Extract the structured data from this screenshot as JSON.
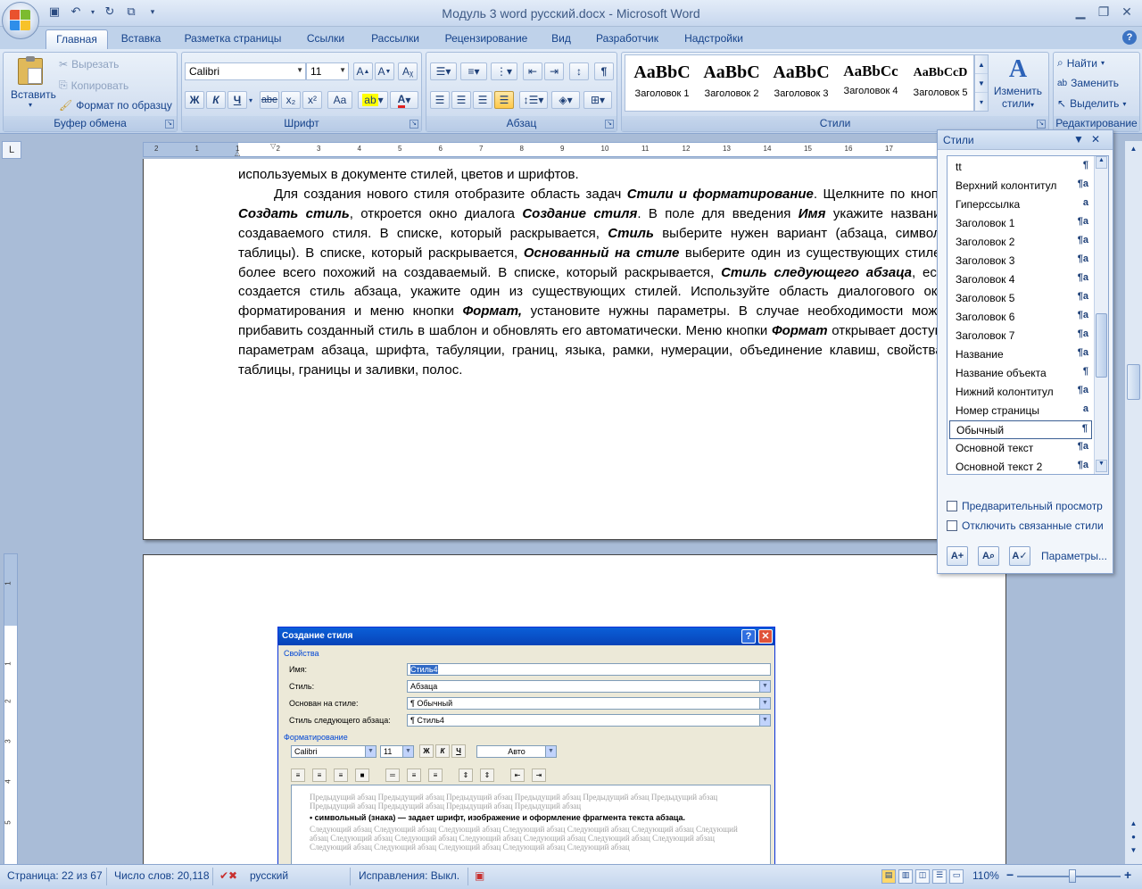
{
  "window": {
    "title": "Модуль 3 word русский.docx - Microsoft Word"
  },
  "tabs": [
    "Главная",
    "Вставка",
    "Разметка страницы",
    "Ссылки",
    "Рассылки",
    "Рецензирование",
    "Вид",
    "Разработчик",
    "Надстройки"
  ],
  "ribbon": {
    "clipboard": {
      "label": "Буфер обмена",
      "paste": "Вставить",
      "cut": "Вырезать",
      "copy": "Копировать",
      "format_painter": "Формат по образцу"
    },
    "font": {
      "label": "Шрифт",
      "font_name": "Calibri",
      "font_size": "11",
      "bold": "Ж",
      "italic": "К",
      "underline": "Ч",
      "strike": "abe",
      "subscript": "x₂",
      "superscript": "x²",
      "case": "Aa"
    },
    "paragraph": {
      "label": "Абзац"
    },
    "styles": {
      "label": "Стили",
      "gallery": [
        {
          "sample": "AaBbC",
          "name": "Заголовок 1"
        },
        {
          "sample": "AaBbC",
          "name": "Заголовок 2"
        },
        {
          "sample": "AaBbC",
          "name": "Заголовок 3"
        },
        {
          "sample": "AaBbCc",
          "name": "Заголовок 4"
        },
        {
          "sample": "AaBbCcD",
          "name": "Заголовок 5"
        }
      ],
      "change_styles_1": "Изменить",
      "change_styles_2": "стили"
    },
    "editing": {
      "label": "Редактирование",
      "find": "Найти",
      "replace": "Заменить",
      "select": "Выделить"
    }
  },
  "document": {
    "line_top": "используемых в документе стилей, цветов и шрифтов.",
    "paragraph": [
      {
        "t": "Для создания нового стиля отобразите область задач "
      },
      {
        "b": "Стили и форматирование"
      },
      {
        "t": ". Щелкните по кнопке "
      },
      {
        "b": "Создать стиль"
      },
      {
        "t": ", откроется окно диалога "
      },
      {
        "b": "Создание стиля"
      },
      {
        "t": ". В поле для введения "
      },
      {
        "b": "Имя"
      },
      {
        "t": " укажите название, создаваемого стиля. В списке, который раскрывается, "
      },
      {
        "b": "Стиль"
      },
      {
        "t": " выберите нужен вариант (абзаца, символа, таблицы). В списке, который раскрывается, "
      },
      {
        "b": "Основанный на стиле"
      },
      {
        "t": " выберите один из существующих стилей, более всего похожий на создаваемый. В списке, который раскрывается, "
      },
      {
        "b": "Стиль следующего абзаца"
      },
      {
        "t": ", если создается стиль абзаца, укажите один из существующих стилей. Используйте область диалогового окна форматирования и меню кнопки "
      },
      {
        "b": "Формат,"
      },
      {
        "t": " установите нужны параметры. В случае необходимости можно прибавить созданный стиль в шаблон и обновлять его автоматически. Меню кнопки "
      },
      {
        "b": "Формат"
      },
      {
        "t": " открывает доступ к параметрам абзаца, шрифта, табуляции, границ, языка, рамки, нумерации, объединение клавиш, свойствам таблицы, границы и заливки, полос."
      }
    ]
  },
  "dialog": {
    "title": "Создание стиля",
    "section_props": "Свойства",
    "name_label": "Имя:",
    "name_value": "Стиль4",
    "style_label": "Стиль:",
    "style_value": "Абзаца",
    "based_label": "Основан на стиле:",
    "based_value": "¶ Обычный",
    "next_label": "Стиль следующего абзаца:",
    "next_value": "¶ Стиль4",
    "section_format": "Форматирование",
    "font": "Calibri",
    "size": "11",
    "color": "Авто",
    "prev_text": "Предыдущий абзац Предыдущий абзац Предыдущий абзац Предыдущий абзац Предыдущий абзац Предыдущий абзац Предыдущий абзац Предыдущий абзац Предыдущий абзац Предыдущий абзац",
    "main_text": "• символьный (знака) — задает шрифт, изображение и оформление фрагмента текста абзаца.",
    "next_text": "Следующий абзац Следующий абзац Следующий абзац Следующий абзац Следующий абзац Следующий абзац Следующий абзац Следующий абзац Следующий абзац Следующий абзац Следующий абзац Следующий абзац Следующий абзац Следующий абзац Следующий абзац Следующий абзац Следующий абзац Следующий абзац"
  },
  "styles_pane": {
    "title": "Стили",
    "items": [
      {
        "name": "tt",
        "mark": "¶"
      },
      {
        "name": "Верхний колонтитул",
        "mark": "¶a"
      },
      {
        "name": "Гиперссылка",
        "mark": "a"
      },
      {
        "name": "Заголовок 1",
        "mark": "¶a"
      },
      {
        "name": "Заголовок 2",
        "mark": "¶a"
      },
      {
        "name": "Заголовок 3",
        "mark": "¶a"
      },
      {
        "name": "Заголовок 4",
        "mark": "¶a"
      },
      {
        "name": "Заголовок 5",
        "mark": "¶a"
      },
      {
        "name": "Заголовок 6",
        "mark": "¶a"
      },
      {
        "name": "Заголовок 7",
        "mark": "¶a"
      },
      {
        "name": "Название",
        "mark": "¶a"
      },
      {
        "name": "Название объекта",
        "mark": "¶"
      },
      {
        "name": "Нижний колонтитул",
        "mark": "¶a"
      },
      {
        "name": "Номер страницы",
        "mark": "a"
      },
      {
        "name": "Обычный",
        "mark": "¶",
        "selected": true
      },
      {
        "name": "Основной текст",
        "mark": "¶a"
      },
      {
        "name": "Основной текст 2",
        "mark": "¶a"
      }
    ],
    "preview_label": "Предварительный просмотр",
    "disable_linked_label": "Отключить связанные стили",
    "options_link": "Параметры..."
  },
  "status": {
    "page": "Страница: 22 из 67",
    "words": "Число слов: 20,118",
    "language": "русский",
    "track_changes": "Исправления: Выкл.",
    "zoom": "110%"
  },
  "ruler": {
    "h_numbers": [
      "2",
      "1",
      "1",
      "2",
      "3",
      "4",
      "5",
      "6",
      "7",
      "8",
      "9",
      "10",
      "11",
      "12",
      "13",
      "14",
      "15",
      "16",
      "17"
    ]
  }
}
